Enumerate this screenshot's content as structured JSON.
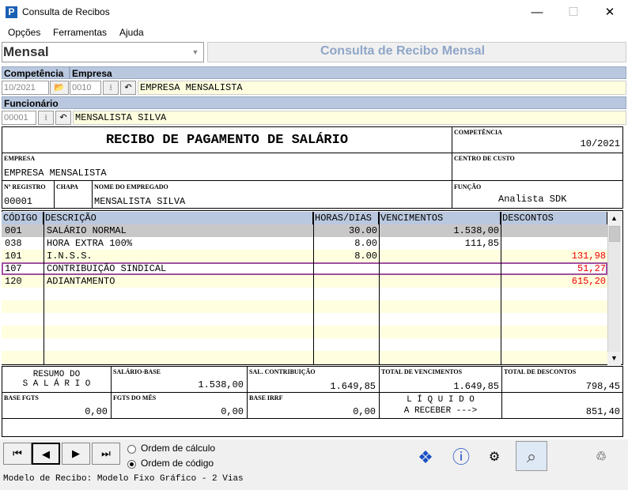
{
  "window": {
    "title": "Consulta de Recibos",
    "app_icon_letter": "P"
  },
  "menu": [
    {
      "label": "Opções",
      "accel": "O"
    },
    {
      "label": "Ferramentas",
      "accel": "F"
    },
    {
      "label": "Ajuda",
      "accel": "A"
    }
  ],
  "mode": {
    "value": "Mensal",
    "header": "Consulta de Recibo Mensal"
  },
  "filters": {
    "competencia_label": "Competência",
    "empresa_label": "Empresa",
    "competencia_value": "10/2021",
    "empresa_code": "0010",
    "empresa_name": "EMPRESA MENSALISTA",
    "funcionario_label": "Funcionário",
    "funcionario_code": "00001",
    "funcionario_name": "MENSALISTA SILVA"
  },
  "receipt": {
    "title": "RECIBO DE PAGAMENTO DE SALÁRIO",
    "competencia_label": "COMPETÊNCIA",
    "competencia_value": "10/2021",
    "empresa_label": "EMPRESA",
    "empresa_value": "EMPRESA MENSALISTA",
    "centro_label": "CENTRO DE CUSTO",
    "registro_label": "Nº REGISTRO",
    "registro_value": "00001",
    "chapa_label": "CHAPA",
    "nome_label": "NOME DO EMPREGADO",
    "nome_value": "MENSALISTA SILVA",
    "funcao_label": "FUNÇÃO",
    "funcao_value": "Analista SDK"
  },
  "table": {
    "headers": [
      "CÓDIGO",
      "DESCRIÇÃO",
      "HORAS/DIAS",
      "VENCIMENTOS",
      "DESCONTOS"
    ],
    "rows": [
      {
        "code": "001",
        "desc": "SALÁRIO NORMAL",
        "hours": "30.00",
        "venc": "1.538,00",
        "desc_val": ""
      },
      {
        "code": "038",
        "desc": "HORA EXTRA 100%",
        "hours": "8.00",
        "venc": "111,85",
        "desc_val": ""
      },
      {
        "code": "101",
        "desc": "I.N.S.S.",
        "hours": "8.00",
        "venc": "",
        "desc_val": "131,98"
      },
      {
        "code": "107",
        "desc": "CONTRIBUIÇÃO SINDICAL",
        "hours": "",
        "venc": "",
        "desc_val": "51,27"
      },
      {
        "code": "120",
        "desc": "ADIANTAMENTO",
        "hours": "",
        "venc": "",
        "desc_val": "615,20"
      }
    ]
  },
  "summary": {
    "resumo_line1": "RESUMO DO",
    "resumo_line2": "S A L Á R I O",
    "salario_base_label": "SALÁRIO-BASE",
    "salario_base_value": "1.538,00",
    "sal_contrib_label": "SAL. CONTRIBUIÇÃO",
    "sal_contrib_value": "1.649,85",
    "total_venc_label": "TOTAL DE VENCIMENTOS",
    "total_venc_value": "1.649,85",
    "total_desc_label": "TOTAL DE DESCONTOS",
    "total_desc_value": "798,45",
    "base_fgts_label": "BASE FGTS",
    "base_fgts_value": "0,00",
    "fgts_mes_label": "FGTS DO MÊS",
    "fgts_mes_value": "0,00",
    "base_irrf_label": "BASE IRRF",
    "base_irrf_value": "0,00",
    "liquido_line1": "L Í Q U I D O",
    "liquido_line2": "A RECEBER --->",
    "liquido_value": "851,40"
  },
  "footer": {
    "radio_calc": "Ordem de cálculo",
    "radio_code": "Ordem de código",
    "status": "Modelo de Recibo: Modelo Fixo Gráfico - 2 Vias"
  }
}
